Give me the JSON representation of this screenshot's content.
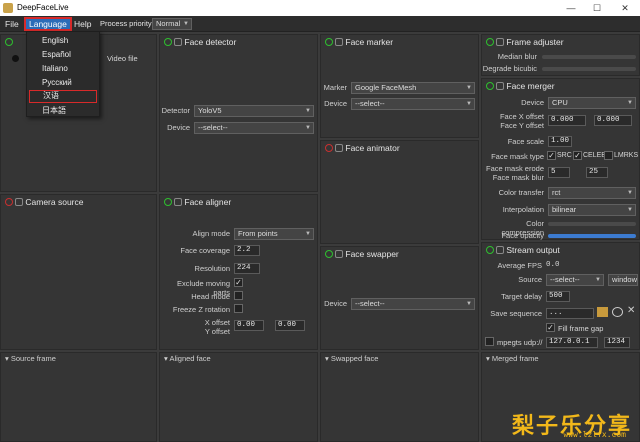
{
  "window": {
    "title": "DeepFaceLive",
    "min": "—",
    "max": "☐",
    "close": "✕"
  },
  "menu": {
    "file": "File",
    "language": "Language",
    "help": "Help",
    "process_priority_label": "Process priority",
    "process_priority_value": "Normal"
  },
  "language_menu": [
    "English",
    "Español",
    "Italiano",
    "Русский",
    "汉语",
    "日本語"
  ],
  "file_source": {
    "option": "Video file"
  },
  "camera_source": {
    "title": "Camera source"
  },
  "face_detector": {
    "title": "Face detector",
    "detector_label": "Detector",
    "detector_value": "YoloV5",
    "device_label": "Device",
    "device_value": "--select--"
  },
  "face_marker": {
    "title": "Face marker",
    "marker_label": "Marker",
    "marker_value": "Google FaceMesh",
    "device_label": "Device",
    "device_value": "--select--"
  },
  "face_animator": {
    "title": "Face animator"
  },
  "face_swapper": {
    "title": "Face swapper",
    "device_label": "Device",
    "device_value": "--select--"
  },
  "face_aligner": {
    "title": "Face aligner",
    "align_mode_label": "Align mode",
    "align_mode_value": "From points",
    "face_coverage_label": "Face coverage",
    "face_coverage_value": "2.2",
    "resolution_label": "Resolution",
    "resolution_value": "224",
    "exclude_label": "Exclude moving parts",
    "exclude_check": "✓",
    "head_mode_label": "Head mode",
    "freeze_label": "Freeze Z rotation",
    "x_offset_label": "X offset",
    "y_offset_label": "Y offset",
    "x_offset_value": "0.00",
    "y_offset_value": "0.00"
  },
  "frame_adjuster": {
    "title": "Frame adjuster",
    "median_label": "Median blur",
    "degrade_label": "Degrade bicubic"
  },
  "face_merger": {
    "title": "Face merger",
    "device_label": "Device",
    "device_value": "CPU",
    "xy_offset_label": "Face X offset\nFace Y offset",
    "x_value": "0.000",
    "y_value": "0.000",
    "scale_label": "Face scale",
    "scale_value": "1.00",
    "mask_type_label": "Face mask type",
    "mask_src": "SRC",
    "mask_celeb": "CELEB",
    "mask_lmrks": "LMRKS",
    "erode_label": "Face mask erode\nFace mask blur",
    "erode_value": "5",
    "blur_value": "25",
    "color_transfer_label": "Color transfer",
    "color_transfer_value": "rct",
    "interpolation_label": "Interpolation",
    "interpolation_value": "bilinear",
    "compression_label": "Color compression",
    "opacity_label": "Face opacity"
  },
  "stream_output": {
    "title": "Stream output",
    "fps_label": "Average FPS",
    "fps_value": "0.0",
    "source_label": "Source",
    "source_value": "--select--",
    "window_label": "window",
    "delay_label": "Target delay",
    "delay_value": "500",
    "save_label": "Save sequence",
    "save_value": "...",
    "fill_gap_label": "Fill frame gap",
    "mpegts_label": "mpegts udp://",
    "ip_value": "127.0.0.1",
    "port_value": "1234"
  },
  "frames": {
    "source": "Source frame",
    "aligned": "Aligned face",
    "swapped": "Swapped face",
    "merged": "Merged frame"
  },
  "watermark": {
    "cn": "梨子乐分享",
    "url": "www.lzlfx.com"
  },
  "colors": {
    "accent": "#2b6cb8",
    "highlight": "#d82a2a",
    "power": "#2ec02e",
    "watermark": "#f2b81a"
  }
}
